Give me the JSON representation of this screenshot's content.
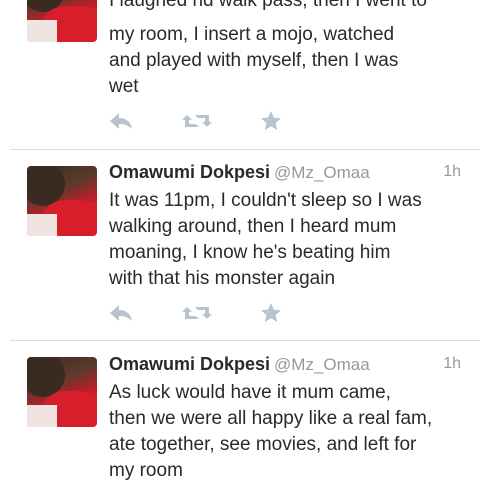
{
  "tweets": [
    {
      "text_lines": [
        "I laughed nd walk pass, then I went to",
        "my room, I insert a mojo, watched",
        "and played with myself, then I was",
        "wet"
      ]
    },
    {
      "name": "Omawumi Dokpesi",
      "handle": "@Mz_Omaa",
      "time": "1h",
      "text_lines": [
        "It was 11pm, I couldn't sleep so I was",
        "walking around, then I heard mum",
        "moaning, I know he's beating him",
        "with that his monster again"
      ]
    },
    {
      "name": "Omawumi Dokpesi",
      "handle": "@Mz_Omaa",
      "time": "1h",
      "text_lines": [
        "As luck would have it mum came,",
        "then we were all happy like a real fam,",
        "ate together, see movies, and left for",
        "my room"
      ]
    }
  ],
  "icons": {
    "reply": "reply-icon",
    "retweet": "retweet-icon",
    "favorite": "star-icon"
  },
  "colors": {
    "icon": "#b8c3cc",
    "divider": "#dcdcdc",
    "meta": "#999999"
  }
}
